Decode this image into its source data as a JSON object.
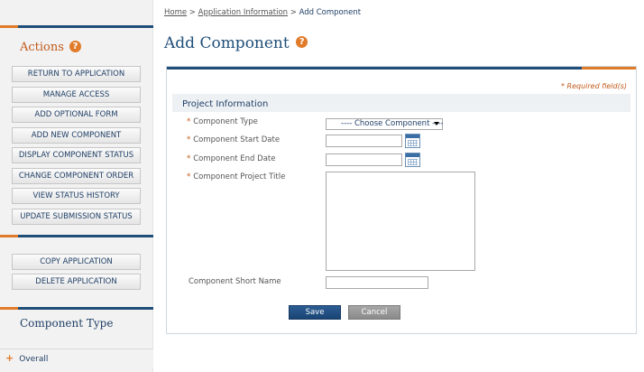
{
  "breadcrumb": {
    "home": "Home",
    "sep1": " > ",
    "app_info": "Application Information",
    "sep2": " > ",
    "current": "Add Component"
  },
  "page": {
    "title": "Add Component",
    "help_glyph": "?"
  },
  "sidebar": {
    "actions_title": "Actions",
    "help_glyph": "?",
    "actions": [
      "RETURN TO APPLICATION",
      "MANAGE ACCESS",
      "ADD OPTIONAL FORM",
      "ADD NEW COMPONENT",
      "DISPLAY COMPONENT STATUS",
      "CHANGE COMPONENT ORDER",
      "VIEW STATUS HISTORY",
      "UPDATE SUBMISSION STATUS"
    ],
    "secondary_actions": [
      "COPY APPLICATION",
      "DELETE APPLICATION"
    ],
    "component_type_title": "Component Type",
    "overall_glyph": "+",
    "overall_label": "Overall"
  },
  "form": {
    "required_note": "* Required field(s)",
    "section_title": "Project Information",
    "required_marker": "*",
    "fields": {
      "component_type": {
        "label": "Component Type",
        "value": "---- Choose Component ----"
      },
      "start_date": {
        "label": "Component Start Date",
        "value": ""
      },
      "end_date": {
        "label": "Component End Date",
        "value": ""
      },
      "project_title": {
        "label": "Component Project Title",
        "value": ""
      },
      "short_name": {
        "label": "Component Short Name",
        "value": ""
      }
    },
    "save_label": "Save",
    "cancel_label": "Cancel"
  },
  "colors": {
    "brand_blue": "#1f4e79",
    "accent_orange": "#e07b2a"
  },
  "icons": [
    "help-icon",
    "calendar-icon",
    "chevron-down-icon",
    "expand-plus-icon"
  ]
}
